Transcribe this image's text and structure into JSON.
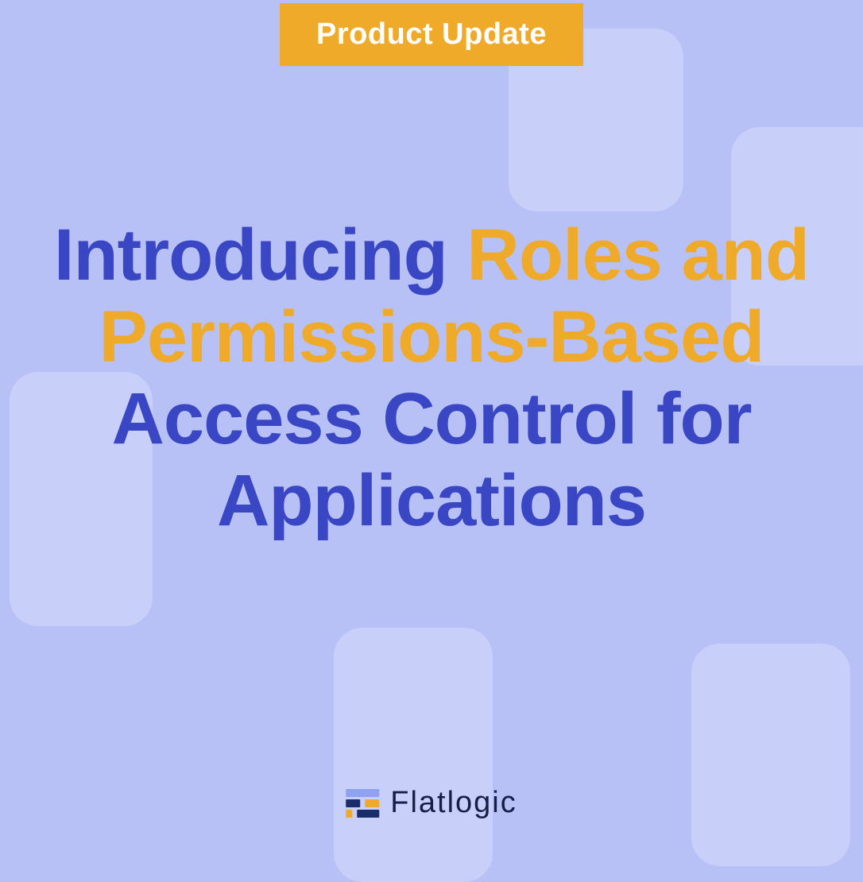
{
  "badge": {
    "label": "Product Update"
  },
  "headline": {
    "part1": "Introducing",
    "accent": "Roles and Permissions-Based",
    "part2": "Access Control for Applications"
  },
  "brand": {
    "name": "Flatlogic"
  },
  "colors": {
    "background": "#b8c1f5",
    "shape": "#c8cff8",
    "badge": "#f0aa2a",
    "headlinePrimary": "#3a47c5",
    "headlineAccent": "#f0aa2a",
    "brandText": "#141f4a"
  }
}
